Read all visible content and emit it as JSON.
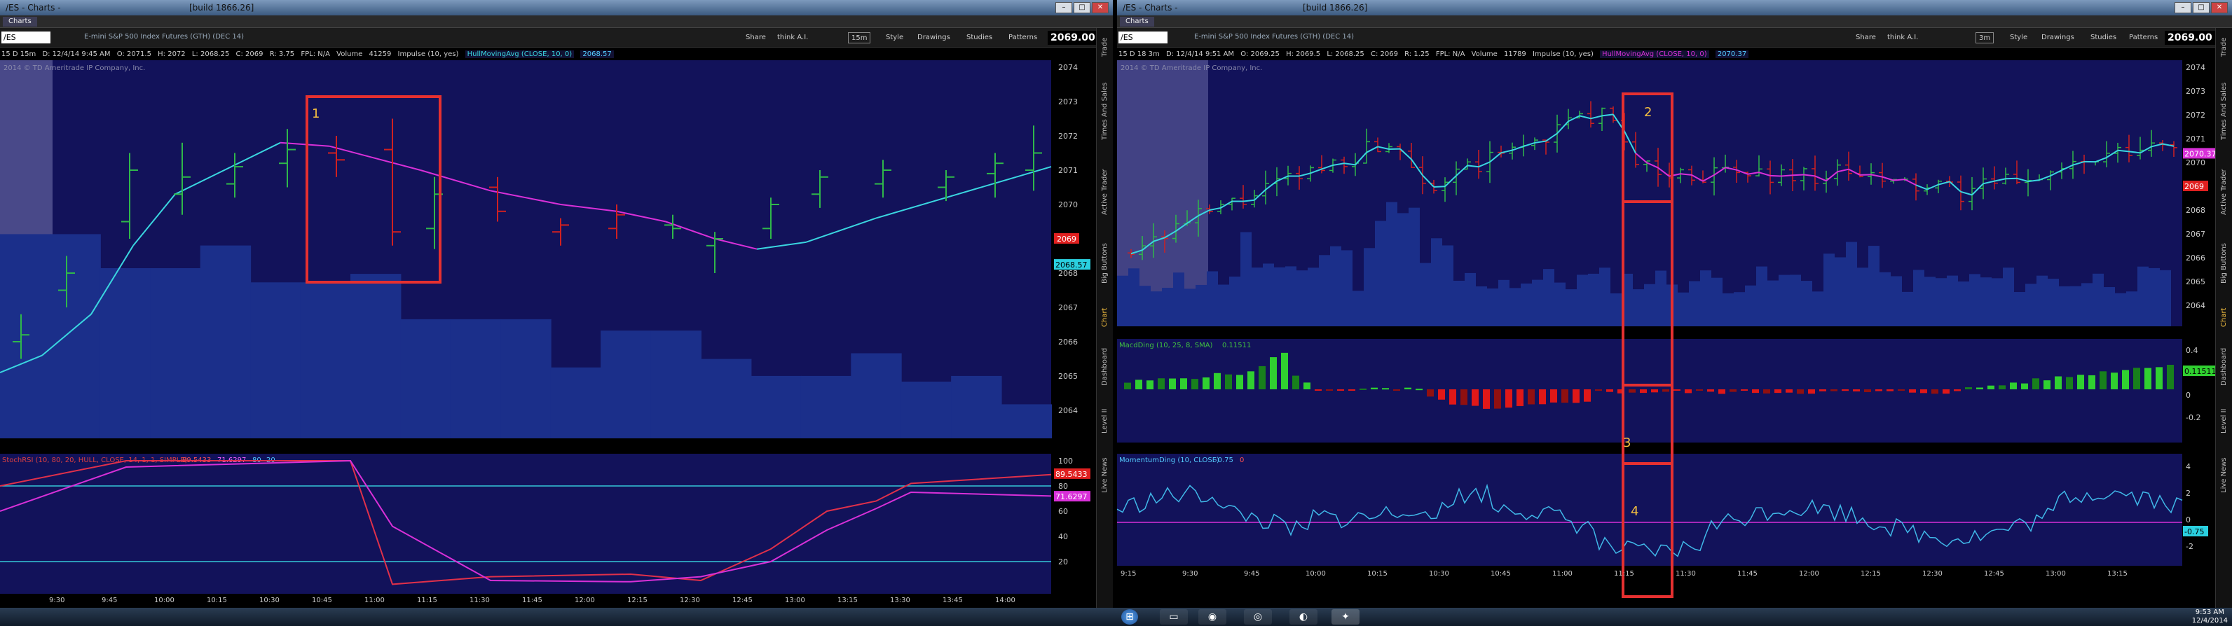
{
  "left": {
    "title": "/ES - Charts -",
    "build": "[build 1866.26]",
    "tab": "Charts",
    "symbol": "/ES",
    "description": "E-mini S&P 500 Index Futures (GTH) (DEC 14)",
    "toolbar": [
      "Share",
      "think A.I.",
      "15m",
      "Style",
      "Drawings",
      "Studies",
      "Patterns"
    ],
    "last_price": "2069.00",
    "info": {
      "period": "15 D 15m",
      "date": "D: 12/4/14 9:45 AM",
      "open": "O: 2071.5",
      "high": "H: 2072",
      "low": "L: 2068.25",
      "close": "C: 2069",
      "range": "R: 3.75",
      "fpl": "FPL: N/A",
      "volume": "Volume",
      "vol_val": "41259",
      "impulse": "Impulse (10, yes)",
      "hma": "HullMovingAvg (CLOSE, 10, 0)",
      "hma_val": "2068.57"
    },
    "copyright": "2014 © TD Ameritrade IP Company, Inc.",
    "annotation": "1",
    "price_ticks": [
      "2074",
      "2073",
      "2072",
      "2071",
      "2070",
      "2069",
      "2068",
      "2067",
      "2066",
      "2065",
      "2064"
    ],
    "price_tags": {
      "last": "2069",
      "hma": "2068.57"
    },
    "lower_study": {
      "label": "StochRSI (10, 80, 20, HULL, CLOSE, 14, 1, 1, SIMPLE)",
      "v1": "89.5433",
      "v2": "71.6297",
      "v3": "80",
      "v4": "20",
      "ticks": [
        "100",
        "80",
        "60",
        "40",
        "20"
      ],
      "tag1": "89.5433",
      "tag2": "71.6297"
    },
    "time_ticks": [
      "9:30",
      "9:45",
      "10:00",
      "10:15",
      "10:30",
      "10:45",
      "11:00",
      "11:15",
      "11:30",
      "11:45",
      "12:00",
      "12:15",
      "12:30",
      "12:45",
      "13:00",
      "13:15",
      "13:30",
      "13:45",
      "14:00"
    ],
    "side_tabs": [
      "Trade",
      "Times And Sales",
      "Active Trader",
      "Big Buttons",
      "Chart",
      "Dashboard",
      "Level II",
      "Live News"
    ]
  },
  "right": {
    "title": "/ES - Charts -",
    "build": "[build 1866.26]",
    "tab": "Charts",
    "symbol": "/ES",
    "description": "E-mini S&P 500 Index Futures (GTH) (DEC 14)",
    "toolbar": [
      "Share",
      "think A.I.",
      "3m",
      "Style",
      "Drawings",
      "Studies",
      "Patterns"
    ],
    "last_price": "2069.00",
    "info": {
      "period": "15 D 18 3m",
      "date": "D: 12/4/14 9:51 AM",
      "open": "O: 2069.25",
      "high": "H: 2069.5",
      "low": "L: 2068.25",
      "close": "C: 2069",
      "range": "R: 1.25",
      "fpl": "FPL: N/A",
      "volume": "Volume",
      "vol_val": "11789",
      "impulse": "Impulse (10, yes)",
      "hma": "HullMovingAvg (CLOSE, 10, 0)",
      "hma_val": "2070.37"
    },
    "copyright": "2014 © TD Ameritrade IP Company, Inc.",
    "annotations": [
      "2",
      "3",
      "4"
    ],
    "price_ticks": [
      "2074",
      "2073",
      "2072",
      "2071",
      "2070",
      "2069",
      "2068",
      "2067",
      "2066",
      "2065",
      "2064"
    ],
    "price_tags": {
      "hma": "2070.37",
      "last": "2069"
    },
    "macd": {
      "label": "MacdDing (10, 25, 8, SMA)",
      "val": "0.11511",
      "ticks": [
        "0.4",
        "0.2",
        "0",
        "-0.2"
      ],
      "tag": "0.11511"
    },
    "momentum": {
      "label": "MomentumDing (10, CLOSE)",
      "v1": "-0.75",
      "v2": "0",
      "ticks": [
        "4",
        "2",
        "0",
        "-2"
      ],
      "tag": "-0.75"
    },
    "time_ticks": [
      "9:15",
      "9:30",
      "9:45",
      "10:00",
      "10:15",
      "10:30",
      "10:45",
      "11:00",
      "11:15",
      "11:30",
      "11:45",
      "12:00",
      "12:15",
      "12:30",
      "12:45",
      "13:00",
      "13:15"
    ],
    "side_tabs": [
      "Trade",
      "Times And Sales",
      "Active Trader",
      "Big Buttons",
      "Chart",
      "Dashboard",
      "Level II",
      "Live News"
    ]
  },
  "taskbar": {
    "time": "9:53 AM",
    "date": "12/4/2014"
  },
  "colors": {
    "chart_bg": "#12125a",
    "annotation": "#e53030",
    "hma": "#d830d8",
    "up": "#2fb84a",
    "down": "#d02020",
    "cyan": "#3ad6e0",
    "volume": "#1b2f8a"
  }
}
